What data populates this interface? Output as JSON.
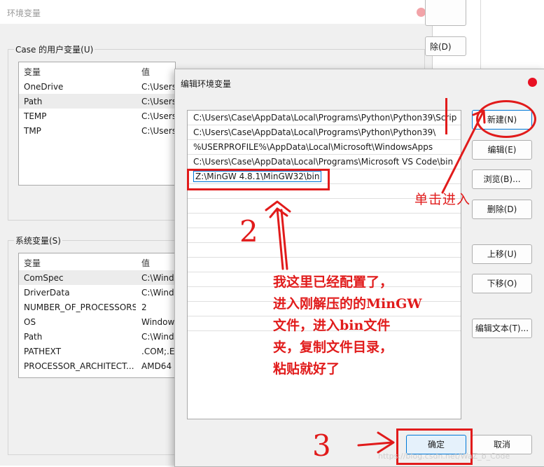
{
  "background_window": {
    "title": "环境变量",
    "user_group_label": "Case 的用户变量(U)",
    "system_group_label": "系统变量(S)",
    "columns": [
      "变量",
      "值"
    ],
    "user_vars": [
      {
        "name": "OneDrive",
        "value": "C:\\Users"
      },
      {
        "name": "Path",
        "value": "C:\\Users"
      },
      {
        "name": "TEMP",
        "value": "C:\\Users"
      },
      {
        "name": "TMP",
        "value": "C:\\Users"
      }
    ],
    "system_vars": [
      {
        "name": "ComSpec",
        "value": "C:\\Wind"
      },
      {
        "name": "DriverData",
        "value": "C:\\Wind"
      },
      {
        "name": "NUMBER_OF_PROCESSORS",
        "value": "2"
      },
      {
        "name": "OS",
        "value": "Window"
      },
      {
        "name": "Path",
        "value": "C:\\Wind"
      },
      {
        "name": "PATHEXT",
        "value": ".COM;.E"
      },
      {
        "name": "PROCESSOR_ARCHITECT...",
        "value": "AMD64"
      }
    ],
    "partial_delete_label": "除(D)"
  },
  "dialog": {
    "title": "编辑环境变量",
    "paths": [
      "C:\\Users\\Case\\AppData\\Local\\Programs\\Python\\Python39\\Scrip",
      "C:\\Users\\Case\\AppData\\Local\\Programs\\Python\\Python39\\",
      "%USERPROFILE%\\AppData\\Local\\Microsoft\\WindowsApps",
      "C:\\Users\\Case\\AppData\\Local\\Programs\\Microsoft VS Code\\bin",
      "Z:\\MinGW 4.8.1\\MinGW32\\bin"
    ],
    "buttons": {
      "new": "新建(N)",
      "edit": "编辑(E)",
      "browse": "浏览(B)...",
      "delete": "删除(D)",
      "move_up": "上移(U)",
      "move_down": "下移(O)",
      "edit_text": "编辑文本(T)...",
      "ok": "确定",
      "cancel": "取消"
    }
  },
  "annotations": {
    "click_to_enter": "单击进入",
    "step2": "2",
    "step3": "3",
    "note_lines": [
      "我这里已经配置了，",
      "进入刚解压的的MinGW",
      "文件，进入bin文件",
      "夹，复制文件目录，",
      "粘贴就好了"
    ],
    "color": "#e11b1b"
  },
  "watermark": "https://blog.csdn.net/WaZ_b_Code"
}
